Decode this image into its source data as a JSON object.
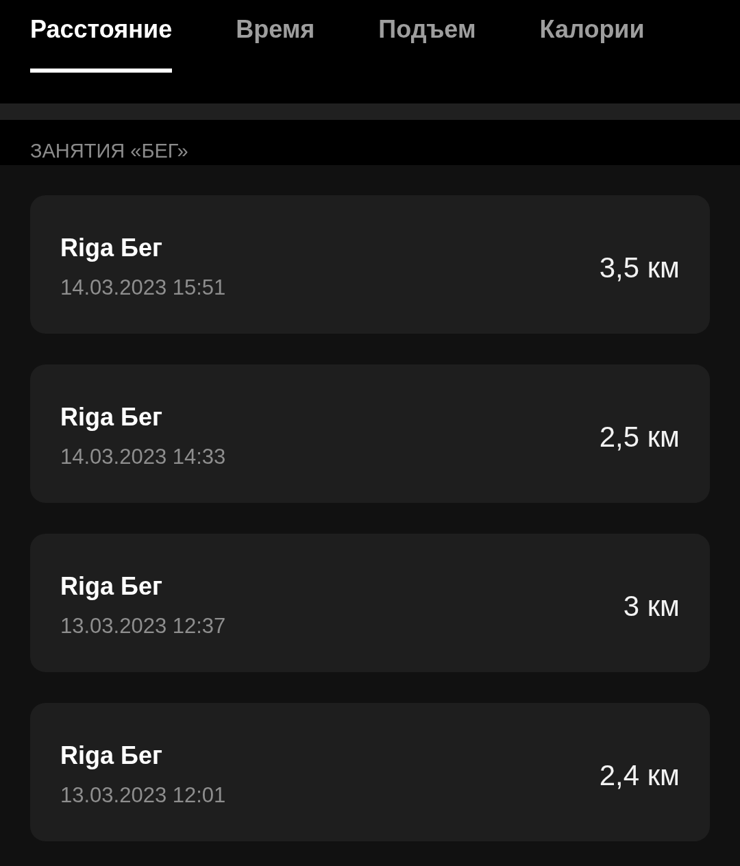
{
  "tabs": [
    {
      "label": "Расстояние",
      "selected": true
    },
    {
      "label": "Время",
      "selected": false
    },
    {
      "label": "Подъем",
      "selected": false
    },
    {
      "label": "Калории",
      "selected": false
    }
  ],
  "section": {
    "title": "ЗАНЯТИЯ «БЕГ»"
  },
  "activities": [
    {
      "title": "Riga Бег",
      "datetime": "14.03.2023 15:51",
      "distance": "3,5 км"
    },
    {
      "title": "Riga Бег",
      "datetime": "14.03.2023 14:33",
      "distance": "2,5 км"
    },
    {
      "title": "Riga Бег",
      "datetime": "13.03.2023 12:37",
      "distance": "3 км"
    },
    {
      "title": "Riga Бег",
      "datetime": "13.03.2023 12:01",
      "distance": "2,4 км"
    }
  ]
}
